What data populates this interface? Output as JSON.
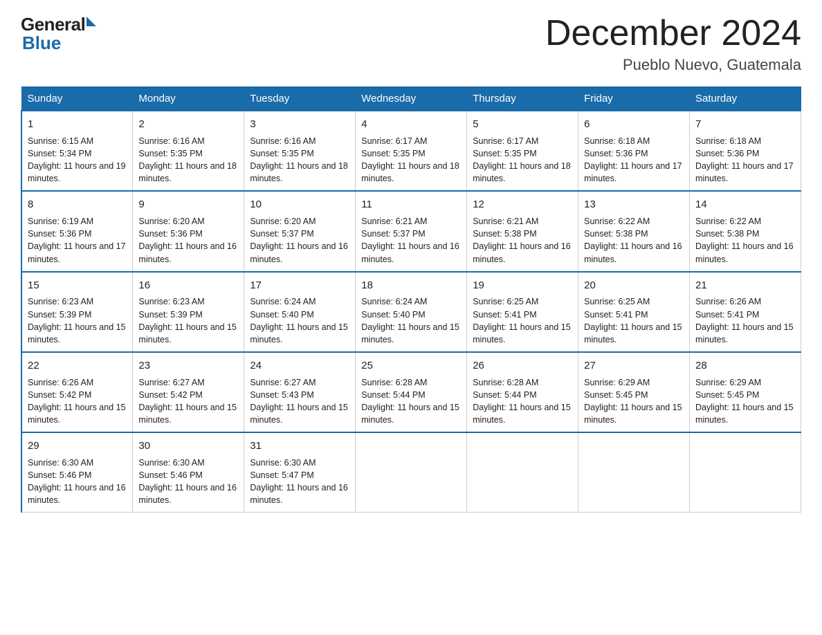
{
  "header": {
    "logo_general": "General",
    "logo_blue": "Blue",
    "month_title": "December 2024",
    "location": "Pueblo Nuevo, Guatemala"
  },
  "weekdays": [
    "Sunday",
    "Monday",
    "Tuesday",
    "Wednesday",
    "Thursday",
    "Friday",
    "Saturday"
  ],
  "weeks": [
    [
      {
        "day": "1",
        "sunrise": "6:15 AM",
        "sunset": "5:34 PM",
        "daylight": "11 hours and 19 minutes."
      },
      {
        "day": "2",
        "sunrise": "6:16 AM",
        "sunset": "5:35 PM",
        "daylight": "11 hours and 18 minutes."
      },
      {
        "day": "3",
        "sunrise": "6:16 AM",
        "sunset": "5:35 PM",
        "daylight": "11 hours and 18 minutes."
      },
      {
        "day": "4",
        "sunrise": "6:17 AM",
        "sunset": "5:35 PM",
        "daylight": "11 hours and 18 minutes."
      },
      {
        "day": "5",
        "sunrise": "6:17 AM",
        "sunset": "5:35 PM",
        "daylight": "11 hours and 18 minutes."
      },
      {
        "day": "6",
        "sunrise": "6:18 AM",
        "sunset": "5:36 PM",
        "daylight": "11 hours and 17 minutes."
      },
      {
        "day": "7",
        "sunrise": "6:18 AM",
        "sunset": "5:36 PM",
        "daylight": "11 hours and 17 minutes."
      }
    ],
    [
      {
        "day": "8",
        "sunrise": "6:19 AM",
        "sunset": "5:36 PM",
        "daylight": "11 hours and 17 minutes."
      },
      {
        "day": "9",
        "sunrise": "6:20 AM",
        "sunset": "5:36 PM",
        "daylight": "11 hours and 16 minutes."
      },
      {
        "day": "10",
        "sunrise": "6:20 AM",
        "sunset": "5:37 PM",
        "daylight": "11 hours and 16 minutes."
      },
      {
        "day": "11",
        "sunrise": "6:21 AM",
        "sunset": "5:37 PM",
        "daylight": "11 hours and 16 minutes."
      },
      {
        "day": "12",
        "sunrise": "6:21 AM",
        "sunset": "5:38 PM",
        "daylight": "11 hours and 16 minutes."
      },
      {
        "day": "13",
        "sunrise": "6:22 AM",
        "sunset": "5:38 PM",
        "daylight": "11 hours and 16 minutes."
      },
      {
        "day": "14",
        "sunrise": "6:22 AM",
        "sunset": "5:38 PM",
        "daylight": "11 hours and 16 minutes."
      }
    ],
    [
      {
        "day": "15",
        "sunrise": "6:23 AM",
        "sunset": "5:39 PM",
        "daylight": "11 hours and 15 minutes."
      },
      {
        "day": "16",
        "sunrise": "6:23 AM",
        "sunset": "5:39 PM",
        "daylight": "11 hours and 15 minutes."
      },
      {
        "day": "17",
        "sunrise": "6:24 AM",
        "sunset": "5:40 PM",
        "daylight": "11 hours and 15 minutes."
      },
      {
        "day": "18",
        "sunrise": "6:24 AM",
        "sunset": "5:40 PM",
        "daylight": "11 hours and 15 minutes."
      },
      {
        "day": "19",
        "sunrise": "6:25 AM",
        "sunset": "5:41 PM",
        "daylight": "11 hours and 15 minutes."
      },
      {
        "day": "20",
        "sunrise": "6:25 AM",
        "sunset": "5:41 PM",
        "daylight": "11 hours and 15 minutes."
      },
      {
        "day": "21",
        "sunrise": "6:26 AM",
        "sunset": "5:41 PM",
        "daylight": "11 hours and 15 minutes."
      }
    ],
    [
      {
        "day": "22",
        "sunrise": "6:26 AM",
        "sunset": "5:42 PM",
        "daylight": "11 hours and 15 minutes."
      },
      {
        "day": "23",
        "sunrise": "6:27 AM",
        "sunset": "5:42 PM",
        "daylight": "11 hours and 15 minutes."
      },
      {
        "day": "24",
        "sunrise": "6:27 AM",
        "sunset": "5:43 PM",
        "daylight": "11 hours and 15 minutes."
      },
      {
        "day": "25",
        "sunrise": "6:28 AM",
        "sunset": "5:44 PM",
        "daylight": "11 hours and 15 minutes."
      },
      {
        "day": "26",
        "sunrise": "6:28 AM",
        "sunset": "5:44 PM",
        "daylight": "11 hours and 15 minutes."
      },
      {
        "day": "27",
        "sunrise": "6:29 AM",
        "sunset": "5:45 PM",
        "daylight": "11 hours and 15 minutes."
      },
      {
        "day": "28",
        "sunrise": "6:29 AM",
        "sunset": "5:45 PM",
        "daylight": "11 hours and 15 minutes."
      }
    ],
    [
      {
        "day": "29",
        "sunrise": "6:30 AM",
        "sunset": "5:46 PM",
        "daylight": "11 hours and 16 minutes."
      },
      {
        "day": "30",
        "sunrise": "6:30 AM",
        "sunset": "5:46 PM",
        "daylight": "11 hours and 16 minutes."
      },
      {
        "day": "31",
        "sunrise": "6:30 AM",
        "sunset": "5:47 PM",
        "daylight": "11 hours and 16 minutes."
      },
      null,
      null,
      null,
      null
    ]
  ]
}
